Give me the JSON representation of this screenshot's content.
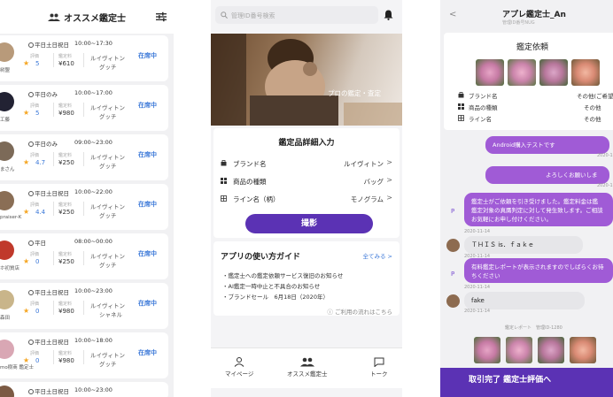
{
  "screen1": {
    "title": "オススメ鑑定士",
    "rating_label": "評価",
    "price_label": "鑑定料",
    "appraisers": [
      {
        "name": "树盟",
        "days": "平日土日祝日",
        "time": "10:00~17:30",
        "rating": "5",
        "price": "¥610",
        "brand1": "ルイヴィトン",
        "brand2": "グッチ",
        "status": "在席中",
        "avatar_color": "#b89a7a"
      },
      {
        "name": "工藤",
        "days": "平日のみ",
        "time": "10:00~17:00",
        "rating": "5",
        "price": "¥980",
        "brand1": "ルイヴィトン",
        "brand2": "グッチ",
        "status": "在席中",
        "avatar_color": "#222233"
      },
      {
        "name": "まさん",
        "days": "平日のみ",
        "time": "09:00~23:00",
        "rating": "4.7",
        "price": "¥250",
        "brand1": "ルイヴィトン",
        "brand2": "グッチ",
        "status": "在席中",
        "avatar_color": "#7c6a58"
      },
      {
        "name": "praiser-K",
        "days": "平日土日祝日",
        "time": "10:00~22:00",
        "rating": "4.4",
        "price": "¥250",
        "brand1": "ルイヴィトン",
        "brand2": "グッチ",
        "status": "在席中",
        "avatar_color": "#8a6e55"
      },
      {
        "name": "ホ初質店",
        "days": "平日",
        "time": "08:00~00:00",
        "rating": "0",
        "price": "¥250",
        "brand1": "ルイヴィトン",
        "brand2": "グッチ",
        "status": "在席中",
        "avatar_color": "#c0392b"
      },
      {
        "name": "森田",
        "days": "平日土日祝日",
        "time": "10:00~23:00",
        "rating": "0",
        "price": "¥980",
        "brand1": "ルイヴィトン",
        "brand2": "シャネル",
        "status": "在席中",
        "avatar_color": "#c9b58a"
      },
      {
        "name": "mo樹商 鑑定士",
        "days": "平日土日祝日",
        "time": "10:00~18:00",
        "rating": "0",
        "price": "¥980",
        "brand1": "ルイヴィトン",
        "brand2": "グッチ",
        "status": "在席中",
        "avatar_color": "#d9a7b4"
      }
    ],
    "partial_days": "平日土日祝日",
    "partial_time": "10:00~23:00"
  },
  "screen2": {
    "search_placeholder": "管理ID番号検索",
    "hero_caption": "プロの鑑定・査定",
    "panel_title": "鑑定品詳細入力",
    "rows": [
      {
        "key": "ブランド名",
        "value": "ルイヴィトン"
      },
      {
        "key": "商品の種類",
        "value": "バッグ"
      },
      {
        "key": "ライン名（柄）",
        "value": "モノグラム"
      }
    ],
    "chevron": ">",
    "shoot_label": "撮影",
    "usage_title": "アプリの使い方ガイド",
    "usage_more": "全てみる >",
    "usage_items": [
      "・鑑定士への鑑定依頼サービス復旧のお知らせ",
      "・AI鑑定一時中止と不具合のお知らせ",
      "・ブランドセール　6月18日（2020年）"
    ],
    "flow_link": "ⓘ ご利用の流れはこちら",
    "tabs": [
      "マイページ",
      "オススメ鑑定士",
      "トーク"
    ]
  },
  "screen3": {
    "back": "<",
    "title": "アプレ鑑定士_An",
    "subtitle": "管理ID番号NUG",
    "request_title": "鑑定依頼",
    "rows": [
      {
        "key": "ブランド名",
        "value": "その他(ご希望ブ"
      },
      {
        "key": "商品の種類",
        "value": "その他"
      },
      {
        "key": "ライン名",
        "value": "その他"
      }
    ],
    "msg1": "Android購入テストです",
    "ts1": "2020-11",
    "msg2": "よろしくお願いしま",
    "ts2": "2020-11",
    "msg3_lines": [
      "鑑定士がご依頼を引き受けました。鑑定料金は鑑",
      "鑑定対象の真贋判定に対して発生致します。ご相談",
      "お気軽にお申し付けください。"
    ],
    "ts3": "2020-11-14",
    "msg4": "ＴＨＩＳ is．ｆａｋｅ",
    "ts4": "2020-11-14",
    "msg5_lines": [
      "有料鑑定レポートが表示されますのでしばらくお待",
      "ちください"
    ],
    "ts5": "2020-11-14",
    "msg6": "fake",
    "ts6": "2020-11-14",
    "ptag": "P",
    "report_label": "鑑定レポート　管理ID-1280",
    "done_label": "取引完了 鑑定士評価へ"
  }
}
